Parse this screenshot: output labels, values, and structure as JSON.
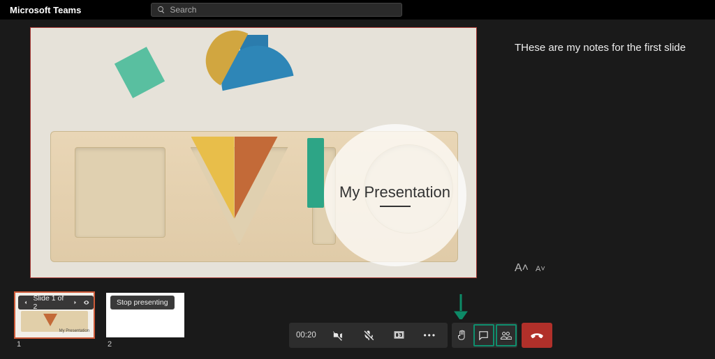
{
  "app": {
    "name": "Microsoft Teams"
  },
  "search": {
    "placeholder": "Search"
  },
  "presentation": {
    "title": "My Presentation",
    "notes": "THese are my notes for the first slide"
  },
  "fontControls": {
    "increase": "A˄",
    "decrease": "A˅"
  },
  "thumbnails": {
    "navLabel": "Slide 1 of 2",
    "stopLabel": "Stop presenting",
    "slide1Number": "1",
    "slide2Number": "2",
    "miniTitle": "My Presentation"
  },
  "call": {
    "timer": "00:20",
    "moreLabel": "•••"
  }
}
